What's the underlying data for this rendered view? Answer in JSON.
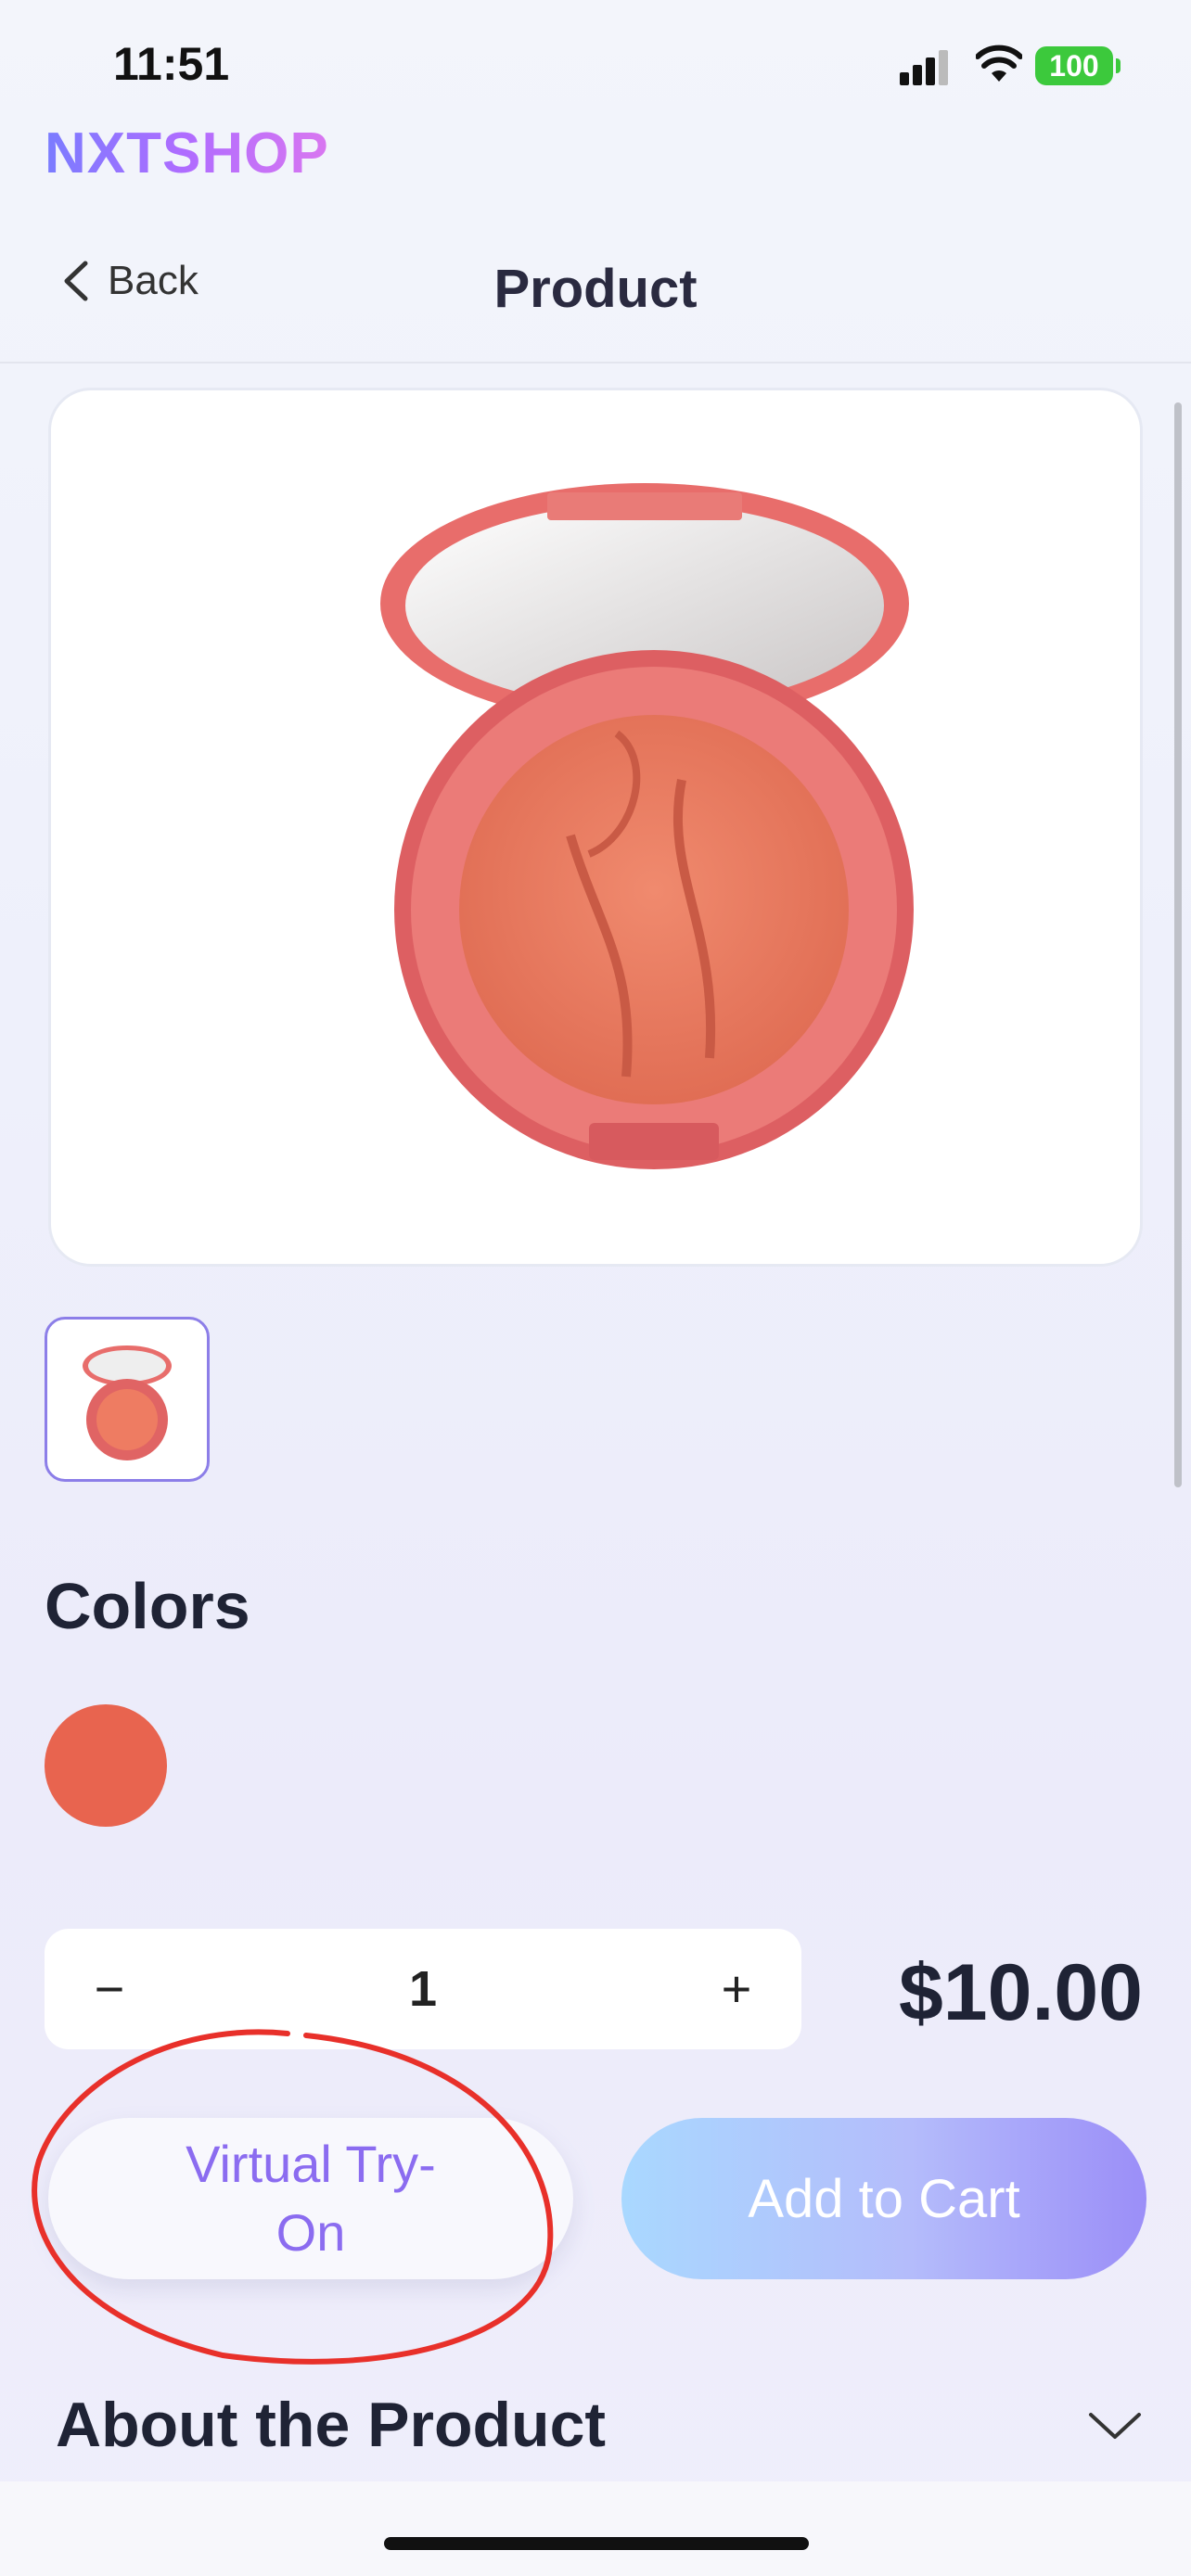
{
  "status_bar": {
    "time": "11:51",
    "battery": "100"
  },
  "brand": "NXTSHOP",
  "nav": {
    "back_label": "Back",
    "title": "Product"
  },
  "product": {
    "colors_heading": "Colors",
    "selected_color": "#e8644f",
    "quantity": "1",
    "quantity_minus": "−",
    "quantity_plus": "+",
    "price": "$10.00"
  },
  "actions": {
    "try_on_label": "Virtual Try-On",
    "add_to_cart_label": "Add to Cart"
  },
  "sections": {
    "about_heading": "About the Product"
  },
  "colors": {
    "accent": "#8b6cf0",
    "annotation": "#e8302a"
  }
}
